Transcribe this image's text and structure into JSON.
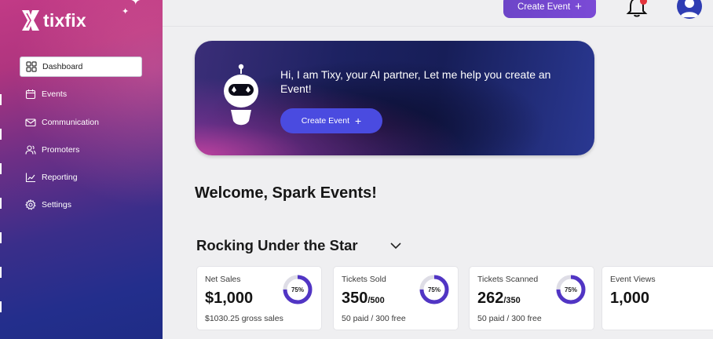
{
  "brand": {
    "name": "tixfix"
  },
  "nav": {
    "items": [
      {
        "label": "Dashboard",
        "icon": "grid-icon",
        "active": true
      },
      {
        "label": "Events",
        "icon": "calendar-icon",
        "active": false
      },
      {
        "label": "Communication",
        "icon": "mail-icon",
        "active": false
      },
      {
        "label": "Promoters",
        "icon": "users-icon",
        "active": false
      },
      {
        "label": "Reporting",
        "icon": "chart-icon",
        "active": false
      },
      {
        "label": "Settings",
        "icon": "gear-icon",
        "active": false
      }
    ]
  },
  "header": {
    "create_label": "Create Event",
    "icons": [
      "bell-icon",
      "user-avatar-icon"
    ]
  },
  "hero": {
    "message": "Hi, I am Tixy, your AI partner, Let me help you create an Event!",
    "button_label": "Create Event"
  },
  "welcome": "Welcome, Spark Events!",
  "event": {
    "name": "Rocking Under the Star"
  },
  "stats": [
    {
      "label": "Net Sales",
      "value": "$1,000",
      "value_suffix": "",
      "sub": "$1030.25 gross sales",
      "percent": 75,
      "percent_label": "75%"
    },
    {
      "label": "Tickets Sold",
      "value": "350",
      "value_suffix": "/500",
      "sub": "50 paid / 300 free",
      "percent": 75,
      "percent_label": "75%"
    },
    {
      "label": "Tickets Scanned",
      "value": "262",
      "value_suffix": "/350",
      "sub": "50 paid / 300 free",
      "percent": 75,
      "percent_label": "75%"
    },
    {
      "label": "Event Views",
      "value": "1,000",
      "value_suffix": "",
      "sub": ""
    }
  ],
  "colors": {
    "accent": "#4a4be0",
    "ring": "#5135c4",
    "ring_track": "#dedde6",
    "create_button": "#7049cf",
    "notification": "#e3343c"
  }
}
